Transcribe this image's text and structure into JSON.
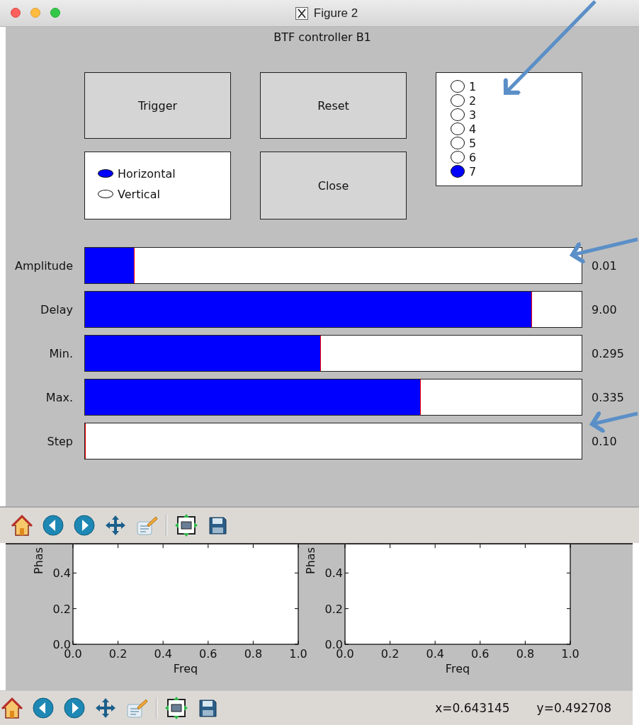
{
  "window": {
    "title": "Figure 2"
  },
  "figure": {
    "title": "BTF controller B1"
  },
  "buttons": [
    {
      "label": "Trigger"
    },
    {
      "label": "Reset"
    },
    {
      "label": "Close"
    }
  ],
  "orientation": [
    {
      "label": "Horizontal",
      "selected": true
    },
    {
      "label": "Vertical",
      "selected": false
    }
  ],
  "channels": [
    {
      "label": "1",
      "selected": false
    },
    {
      "label": "2",
      "selected": false
    },
    {
      "label": "3",
      "selected": false
    },
    {
      "label": "4",
      "selected": false
    },
    {
      "label": "5",
      "selected": false
    },
    {
      "label": "6",
      "selected": false
    },
    {
      "label": "7",
      "selected": true
    }
  ],
  "sliders": [
    {
      "label": "Amplitude",
      "level": 0.1,
      "reading": "0.01"
    },
    {
      "label": "Delay",
      "level": 0.9,
      "reading": "9.00"
    },
    {
      "label": "Min.",
      "level": 0.475,
      "reading": "0.295"
    },
    {
      "label": "Max.",
      "level": 0.676,
      "reading": "0.335"
    },
    {
      "label": "Step",
      "level": 0,
      "reading": "0.10"
    }
  ],
  "plots": [
    {
      "chart_data": {
        "type": "line",
        "xlabel": "Freq",
        "ylabel": "Phas",
        "xlim": [
          0,
          1
        ],
        "ylim": [
          0,
          0.56
        ],
        "xticks": [
          {
            "value": 0,
            "label": "0.0"
          },
          {
            "value": 0.2,
            "label": "0.2"
          },
          {
            "value": 0.4,
            "label": "0.4"
          },
          {
            "value": 0.6,
            "label": "0.6"
          },
          {
            "value": 0.8,
            "label": "0.8"
          },
          {
            "value": 1,
            "label": "1.0"
          }
        ],
        "yticks": [
          {
            "value": 0,
            "label": "0.0"
          },
          {
            "value": 0.2,
            "label": "0.2"
          },
          {
            "value": 0.4,
            "label": "0.4"
          }
        ]
      }
    },
    {
      "chart_data": {
        "type": "line",
        "xlabel": "Freq",
        "ylabel": "Phas",
        "xlim": [
          0,
          1
        ],
        "ylim": [
          0,
          0.56
        ],
        "xticks": [
          {
            "value": 0,
            "label": "0.0"
          },
          {
            "value": 0.2,
            "label": "0.2"
          },
          {
            "value": 0.4,
            "label": "0.4"
          },
          {
            "value": 0.6,
            "label": "0.6"
          },
          {
            "value": 0.8,
            "label": "0.8"
          },
          {
            "value": 1,
            "label": "1.0"
          }
        ],
        "yticks": [
          {
            "value": 0,
            "label": "0.0"
          },
          {
            "value": 0.2,
            "label": "0.2"
          },
          {
            "value": 0.4,
            "label": "0.4"
          }
        ]
      }
    }
  ],
  "status": {
    "x": "x=0.643145",
    "y": "y=0.492708"
  }
}
